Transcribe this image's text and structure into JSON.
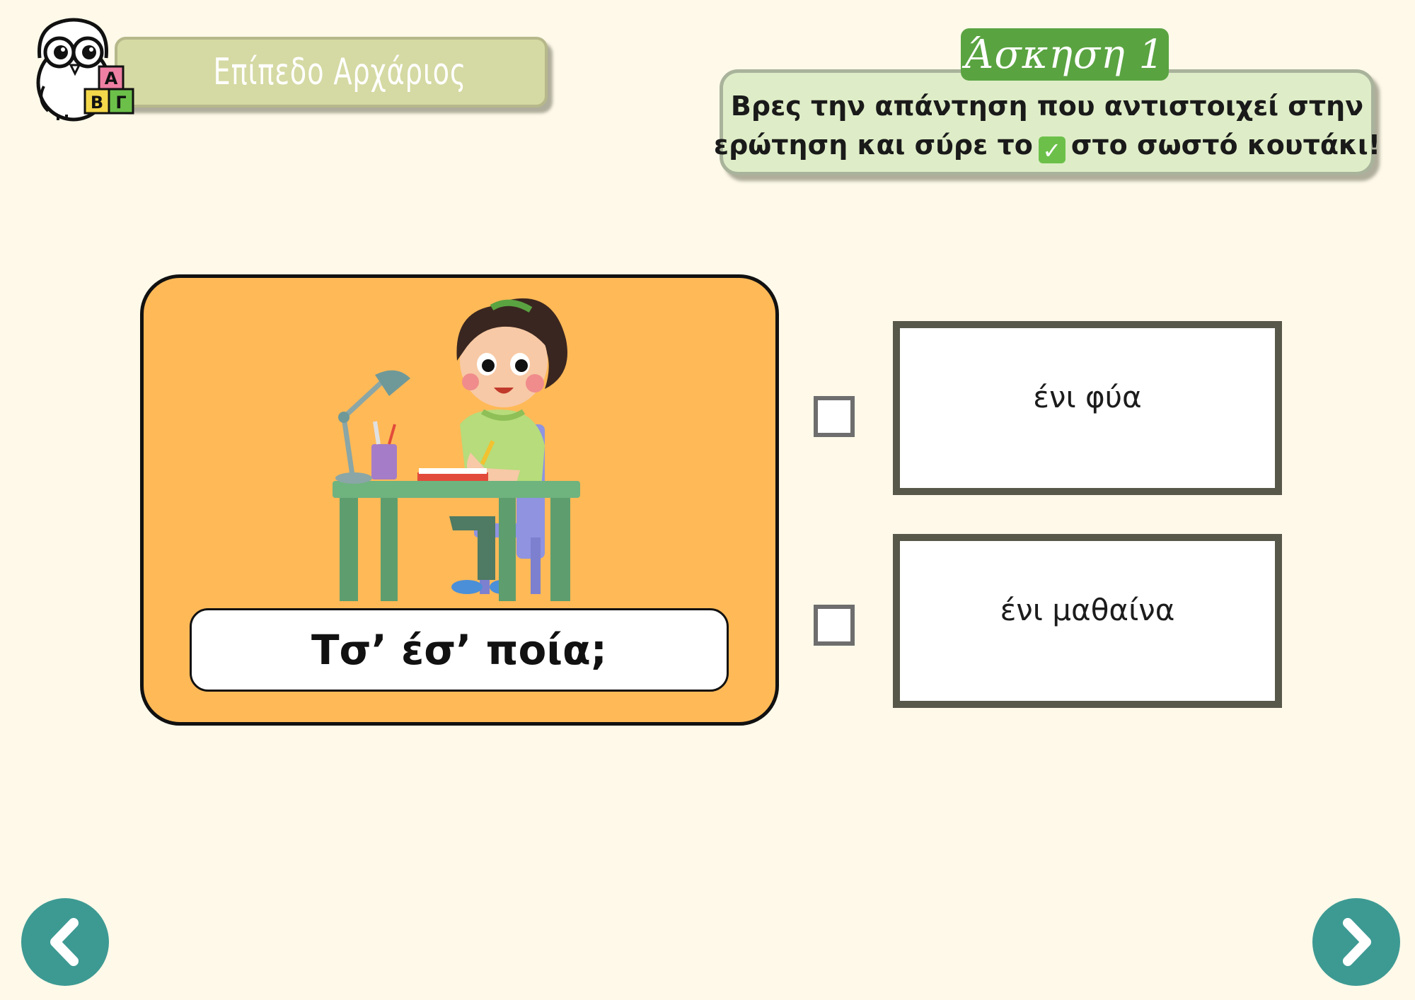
{
  "header": {
    "level_label": "Επίπεδο Αρχάριος",
    "owl_blocks": [
      "Α",
      "Β",
      "Γ"
    ]
  },
  "exercise": {
    "tag": "Άσκηση 1",
    "instruction_line1": "Βρες την απάντηση που αντιστοιχεί στην",
    "instruction_line2_before": "ερώτηση και σύρε το",
    "instruction_line2_after": "στο σωστό κουτάκι!",
    "check_icon": "✓"
  },
  "question": {
    "text": "Τσ’ έσ’ ποία;",
    "illustration": "girl-studying-at-desk"
  },
  "answers": [
    {
      "label": "ένι φύα"
    },
    {
      "label": "ένι μαθαίνα"
    }
  ],
  "navigation": {
    "prev_icon": "chevron-left-icon",
    "next_icon": "chevron-right-icon"
  },
  "colors": {
    "background": "#fef9e9",
    "card": "#ffb957",
    "banner": "#d5d9a3",
    "exercise_box": "#deedc7",
    "exercise_tag": "#5aa341",
    "nav": "#3d9a93",
    "answer_border": "#57574a"
  }
}
